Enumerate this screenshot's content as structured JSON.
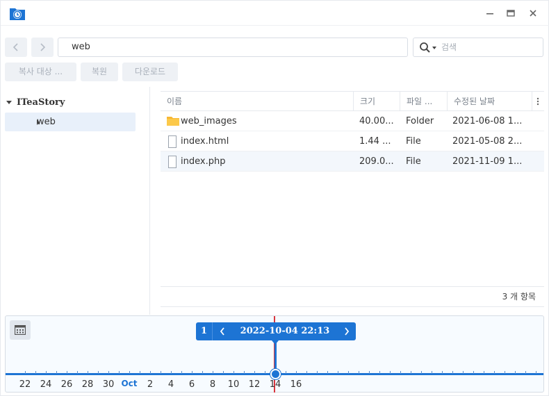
{
  "window": {
    "minimize_icon": "minimize-icon",
    "maximize_icon": "maximize-icon",
    "close_icon": "close-icon"
  },
  "toolbar": {
    "path_value": "web",
    "search_placeholder": "검색",
    "copy_to_label": "복사 대상 ...",
    "restore_label": "복원",
    "download_label": "다운로드"
  },
  "tree": {
    "root_label": "ITeaStory",
    "items": [
      {
        "label": "web"
      }
    ]
  },
  "grid": {
    "columns": [
      "이름",
      "크기",
      "파일 ...",
      "수정된 날짜"
    ],
    "rows": [
      {
        "name": "web_images",
        "size": "40.00...",
        "type": "Folder",
        "modified": "2021-06-08 1...",
        "icon": "folder-icon"
      },
      {
        "name": "index.html",
        "size": "1.44 ...",
        "type": "File",
        "modified": "2021-05-08 2...",
        "icon": "file-icon"
      },
      {
        "name": "index.php",
        "size": "209.0...",
        "type": "File",
        "modified": "2021-11-09 1...",
        "icon": "file-icon"
      }
    ],
    "item_count": "3 개 항목"
  },
  "timeline": {
    "version_number": "1",
    "current_datetime": "2022-10-04 22:13",
    "labels": [
      "22",
      "24",
      "26",
      "28",
      "30",
      "Oct",
      "2",
      "4",
      "6",
      "8",
      "10",
      "12",
      "14",
      "16"
    ],
    "accent": "#1d74d4",
    "marker_color": "#d9363e"
  }
}
